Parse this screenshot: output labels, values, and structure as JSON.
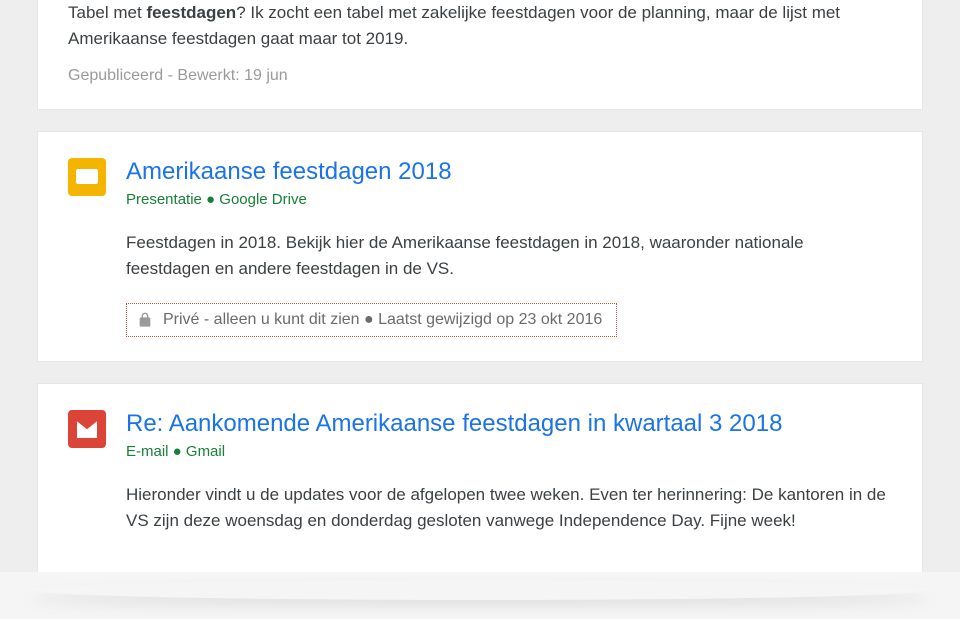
{
  "results": [
    {
      "body_prefix": "Tabel met ",
      "body_bold": "feestdagen",
      "body_suffix": "? Ik zocht een tabel met zakelijke feestdagen voor de planning, maar de lijst met Amerikaanse feestdagen gaat maar tot 2019.",
      "footer": "Gepubliceerd - Bewerkt: 19 jun"
    },
    {
      "title": "Amerikaanse feestdagen 2018",
      "meta": "Presentatie ● Google Drive",
      "body": "Feestdagen in 2018. Bekijk hier de Amerikaanse feestdagen in 2018, waaronder nationale feestdagen en andere feestdagen in de VS.",
      "private_notice": "Privé - alleen u kunt dit zien ● Laatst gewijzigd op 23 okt 2016"
    },
    {
      "title": "Re: Aankomende Amerikaanse feestdagen in kwartaal 3 2018",
      "meta": "E-mail ● Gmail",
      "body": "Hieronder vindt u de updates voor de afgelopen twee weken. Even ter herinnering: De kantoren in de VS zijn deze woensdag en donderdag gesloten vanwege Independence Day. Fijne week!"
    }
  ]
}
